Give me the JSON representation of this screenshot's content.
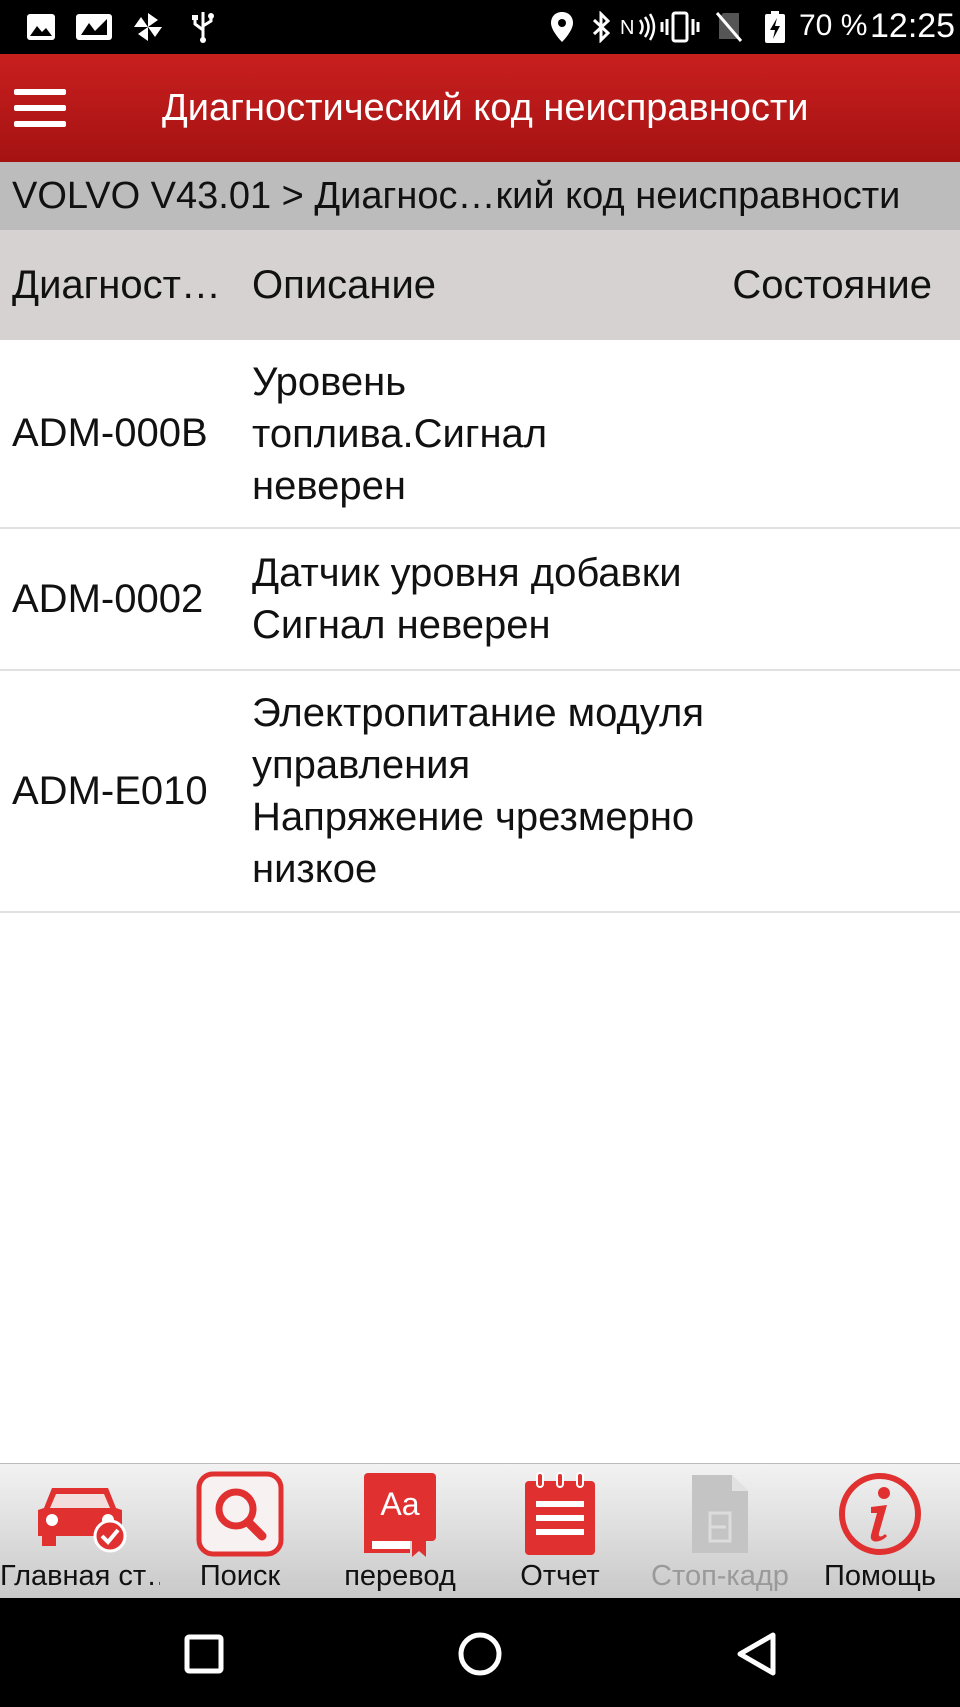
{
  "status_bar": {
    "battery_text": "70 %",
    "time": "12:25",
    "icons": [
      "image-icon",
      "gallery-icon",
      "pinwheel-icon",
      "usb-icon",
      "location-icon",
      "bluetooth-icon",
      "nfc-icon",
      "vibrate-icon",
      "no-sim-icon",
      "battery-charging-icon"
    ]
  },
  "app_bar": {
    "title": "Диагностический код неисправности",
    "menu_icon": "hamburger-menu-icon"
  },
  "breadcrumb": {
    "text": "VOLVO V43.01 > Диагнос…кий код неисправности"
  },
  "table": {
    "headers": {
      "code": "Диагност…",
      "description": "Описание",
      "state": "Состояние"
    },
    "rows": [
      {
        "code": "ADM-000B",
        "description": "Уровень топлива.Сигнал неверен",
        "state": ""
      },
      {
        "code": "ADM-0002",
        "description": "Датчик уровня добавки Сигнал неверен",
        "state": ""
      },
      {
        "code": "ADM-E010",
        "description": "Электропитание модуля управления Напряжение чрезмерно низкое",
        "state": ""
      }
    ]
  },
  "toolbar": {
    "home_label": "Главная ст…",
    "search_label": "Поиск",
    "translate_label": "перевод",
    "report_label": "Отчет",
    "freeze_frame_label": "Стоп-кадр",
    "help_label": "Помощь"
  },
  "colors": {
    "app_bar": "#b81818",
    "accent": "#e02828",
    "breadcrumb_bg": "#bcbcbc",
    "header_bg": "#d6d2d2",
    "disabled": "#9a9a9a"
  }
}
